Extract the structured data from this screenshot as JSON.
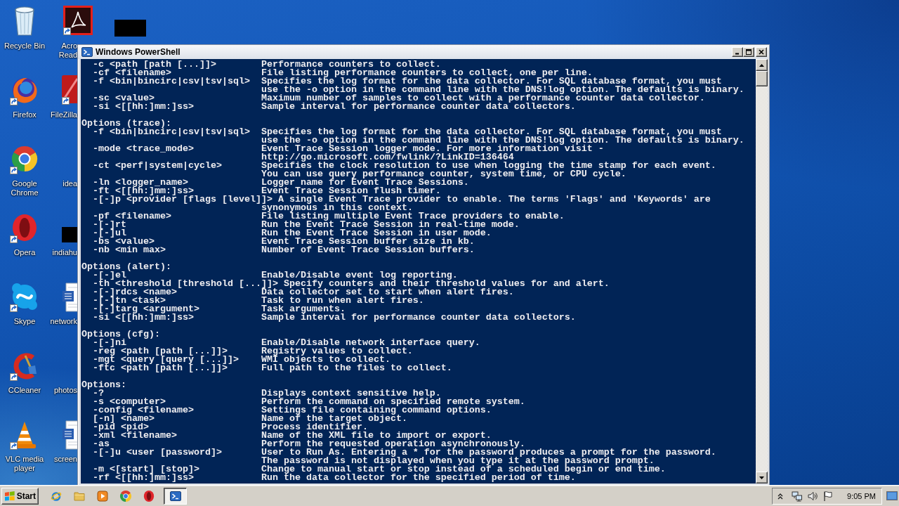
{
  "desktop": {
    "icons": [
      {
        "kind": "recycle-bin",
        "label": "Recycle Bin",
        "shortcut": false
      },
      {
        "kind": "firefox",
        "label": "Firefox",
        "shortcut": true
      },
      {
        "kind": "chrome",
        "label": "Google Chrome",
        "shortcut": true
      },
      {
        "kind": "opera",
        "label": "Opera",
        "shortcut": true
      },
      {
        "kind": "skype",
        "label": "Skype",
        "shortcut": true
      },
      {
        "kind": "ccleaner",
        "label": "CCleaner",
        "shortcut": true
      },
      {
        "kind": "vlc",
        "label": "VLC media player",
        "shortcut": true
      },
      {
        "kind": "acrobat",
        "label": "Acro Read",
        "shortcut": true
      },
      {
        "kind": "filezilla",
        "label": "FileZilla",
        "shortcut": true
      },
      {
        "kind": "label-only",
        "label": "idea"
      },
      {
        "kind": "redacted",
        "label": "indiahu",
        "shortcut": false
      },
      {
        "kind": "word",
        "label": "network",
        "shortcut": false
      },
      {
        "kind": "label-only",
        "label": "photos"
      },
      {
        "kind": "word",
        "label": "screen",
        "shortcut": false
      },
      {
        "kind": "redacted",
        "shortcut": false
      }
    ]
  },
  "window": {
    "title": "Windows PowerShell",
    "console": {
      "sections": [
        {
          "entries": [
            {
              "option": "-c <path [path [...]]>",
              "description": [
                "Performance counters to collect."
              ]
            },
            {
              "option": "-cf <filename>",
              "description": [
                "File listing performance counters to collect, one per line."
              ]
            },
            {
              "option": "-f <bin|bincirc|csv|tsv|sql>",
              "description": [
                "Specifies the log format for the data collector. For SQL database format, you must",
                "use the -o option in the command line with the DNS!log option. The defaults is binary."
              ]
            },
            {
              "option": "-sc <value>",
              "description": [
                "Maximum number of samples to collect with a performance counter data collector."
              ]
            },
            {
              "option": "-si <[[hh:]mm:]ss>",
              "description": [
                "Sample interval for performance counter data collectors."
              ]
            }
          ]
        },
        {
          "heading": "Options (trace):",
          "entries": [
            {
              "option": "-f <bin|bincirc|csv|tsv|sql>",
              "description": [
                "Specifies the log format for the data collector. For SQL database format, you must",
                "use the -o option in the command line with the DNS!log option. The defaults is binary."
              ]
            },
            {
              "option": "-mode <trace_mode>",
              "description": [
                "Event Trace Session logger mode. For more information visit -",
                "http://go.microsoft.com/fwlink/?LinkID=136464"
              ]
            },
            {
              "option": "-ct <perf|system|cycle>",
              "description": [
                "Specifies the clock resolution to use when logging the time stamp for each event.",
                "You can use query performance counter, system time, or CPU cycle."
              ]
            },
            {
              "option": "-ln <logger_name>",
              "description": [
                "Logger name for Event Trace Sessions."
              ]
            },
            {
              "option": "-ft <[[hh:]mm:]ss>",
              "description": [
                "Event Trace Session flush timer."
              ]
            },
            {
              "option": "-[-]p <provider [flags [level]]>",
              "description": [
                "A single Event Trace provider to enable. The terms 'Flags' and 'Keywords' are",
                "synonymous in this context."
              ]
            },
            {
              "option": "-pf <filename>",
              "description": [
                "File listing multiple Event Trace providers to enable."
              ]
            },
            {
              "option": "-[-]rt",
              "description": [
                "Run the Event Trace Session in real-time mode."
              ]
            },
            {
              "option": "-[-]ul",
              "description": [
                "Run the Event Trace Session in user mode."
              ]
            },
            {
              "option": "-bs <value>",
              "description": [
                "Event Trace Session buffer size in kb."
              ]
            },
            {
              "option": "-nb <min max>",
              "description": [
                "Number of Event Trace Session buffers."
              ]
            }
          ]
        },
        {
          "heading": "Options (alert):",
          "entries": [
            {
              "option": "-[-]el",
              "description": [
                "Enable/Disable event log reporting."
              ]
            },
            {
              "option": "-th <threshold [threshold [...]]>",
              "description": [
                "Specify counters and their threshold values for and alert."
              ]
            },
            {
              "option": "-[-]rdcs <name>",
              "description": [
                "Data collector set to start when alert fires."
              ]
            },
            {
              "option": "-[-]tn <task>",
              "description": [
                "Task to run when alert fires."
              ]
            },
            {
              "option": "-[-]targ <argument>",
              "description": [
                "Task arguments."
              ]
            },
            {
              "option": "-si <[[hh:]mm:]ss>",
              "description": [
                "Sample interval for performance counter data collectors."
              ]
            }
          ]
        },
        {
          "heading": "Options (cfg):",
          "entries": [
            {
              "option": "-[-]ni",
              "description": [
                "Enable/Disable network interface query."
              ]
            },
            {
              "option": "-reg <path [path [...]]>",
              "description": [
                "Registry values to collect."
              ]
            },
            {
              "option": "-mgt <query [query [...]]>",
              "description": [
                "WMI objects to collect."
              ]
            },
            {
              "option": "-ftc <path [path [...]]>",
              "description": [
                "Full path to the files to collect."
              ]
            }
          ]
        },
        {
          "heading": "Options:",
          "entries": [
            {
              "option": "-?",
              "description": [
                "Displays context sensitive help."
              ]
            },
            {
              "option": "-s <computer>",
              "description": [
                "Perform the command on specified remote system."
              ]
            },
            {
              "option": "-config <filename>",
              "description": [
                "Settings file containing command options."
              ]
            },
            {
              "option": "[-n] <name>",
              "description": [
                "Name of the target object."
              ]
            },
            {
              "option": "-pid <pid>",
              "description": [
                "Process identifier."
              ]
            },
            {
              "option": "-xml <filename>",
              "description": [
                "Name of the XML file to import or export."
              ]
            },
            {
              "option": "-as",
              "description": [
                "Perform the requested operation asynchronously."
              ]
            },
            {
              "option": "-[-]u <user [password]>",
              "description": [
                "User to Run As. Entering a * for the password produces a prompt for the password.",
                "The password is not displayed when you type it at the password prompt."
              ]
            },
            {
              "option": "-m <[start] [stop]>",
              "description": [
                "Change to manual start or stop instead of a scheduled begin or end time."
              ]
            },
            {
              "option": "-rf <[[hh:]mm:]ss>",
              "description": [
                "Run the data collector for the specified period of time."
              ]
            }
          ]
        }
      ]
    }
  },
  "taskbar": {
    "start": {
      "label": "Start"
    },
    "quick_launch": [
      {
        "kind": "ie"
      },
      {
        "kind": "explorer"
      },
      {
        "kind": "media-player"
      },
      {
        "kind": "chrome"
      },
      {
        "kind": "opera"
      }
    ],
    "tasks": [
      {
        "kind": "powershell",
        "selected": true
      }
    ],
    "tray": {
      "icons": [
        {
          "kind": "chevron"
        },
        {
          "kind": "network"
        },
        {
          "kind": "volume"
        },
        {
          "kind": "action-center"
        }
      ],
      "clock": "9:05 PM"
    }
  }
}
